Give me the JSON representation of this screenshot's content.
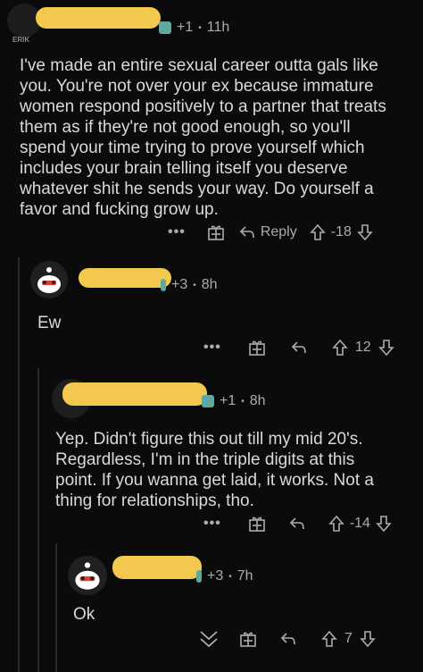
{
  "comments": [
    {
      "score_badge": "+1",
      "age": "11h",
      "flair": "ERIK",
      "text": "I've made an entire sexual career outta gals like you. You're not over your ex because immature women respond positively to a partner that treats them as if they're not good enough, so you'll spend your time trying to prove yourself which includes your brain telling itself you deserve whatever shit he sends your way. Do yourself a favor and fucking grow up.",
      "reply_label": "Reply",
      "votes": "-18"
    },
    {
      "score_badge": "+3",
      "age": "8h",
      "text": "Ew",
      "votes": "12"
    },
    {
      "score_badge": "+1",
      "age": "8h",
      "text": "Yep. Didn't figure this out till my mid 20's. Regardless, I'm in the triple digits at this point. If you wanna get laid, it works. Not a thing for relationships, tho.",
      "votes": "-14"
    },
    {
      "score_badge": "+3",
      "age": "7h",
      "text": "Ok",
      "votes": "7"
    }
  ],
  "separator": "•",
  "more_dots": "•••",
  "colors": {
    "redaction": "#f2c94c",
    "background": "#0b0b0b",
    "text": "#d7dadc",
    "muted": "#a9acaf"
  }
}
